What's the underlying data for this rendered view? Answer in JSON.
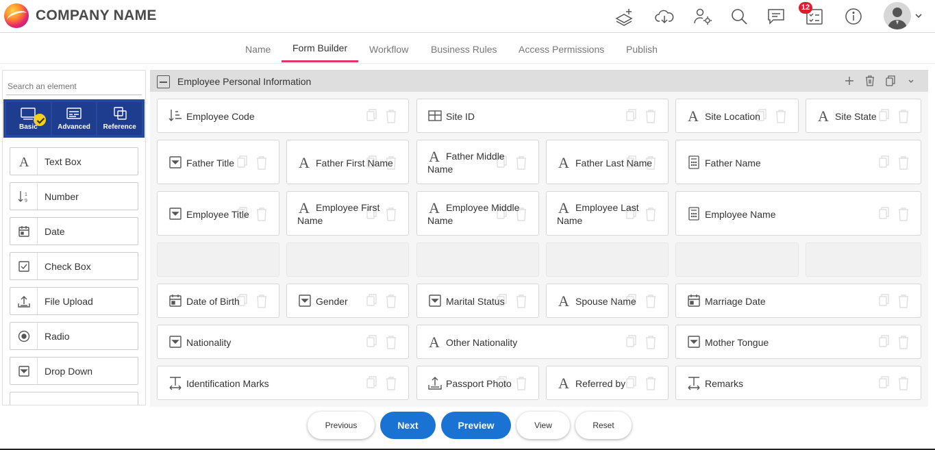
{
  "header": {
    "company_name": "COMPANY NAME",
    "notification_count": "12",
    "icons": [
      "layers-add-icon",
      "cloud-download-icon",
      "users-settings-icon",
      "search-icon",
      "chat-icon",
      "checklist-icon",
      "info-icon",
      "avatar",
      "chevron-down-icon"
    ]
  },
  "tabs": [
    {
      "label": "Name",
      "active": false
    },
    {
      "label": "Form Builder",
      "active": true
    },
    {
      "label": "Workflow",
      "active": false
    },
    {
      "label": "Business Rules",
      "active": false
    },
    {
      "label": "Access Permissions",
      "active": false
    },
    {
      "label": "Publish",
      "active": false
    }
  ],
  "palette": {
    "search_placeholder": "Search an element",
    "categories": [
      {
        "label": "Basic",
        "icon": "basic-icon",
        "selected": true
      },
      {
        "label": "Advanced",
        "icon": "advanced-icon",
        "selected": false
      },
      {
        "label": "Reference",
        "icon": "reference-icon",
        "selected": false
      }
    ],
    "elements": [
      {
        "label": "Text Box",
        "icon": "text-icon"
      },
      {
        "label": "Number",
        "icon": "number-icon"
      },
      {
        "label": "Date",
        "icon": "calendar-icon"
      },
      {
        "label": "Check Box",
        "icon": "checkbox-icon"
      },
      {
        "label": "File Upload",
        "icon": "upload-icon"
      },
      {
        "label": "Radio",
        "icon": "radio-icon"
      },
      {
        "label": "Drop Down",
        "icon": "dropdown-icon"
      }
    ]
  },
  "section": {
    "title": "Employee Personal Information",
    "fields": [
      {
        "line1": "Employee Code",
        "line2": "",
        "icon": "number-sort-icon"
      },
      {
        "line1": "Site ID",
        "line2": "",
        "icon": "table-icon"
      },
      {
        "line1": "Site Location",
        "line2": "",
        "icon": "text-icon"
      },
      {
        "line1": "Site State",
        "line2": "",
        "icon": "text-icon"
      },
      {
        "line1": "Father Title",
        "line2": "",
        "icon": "dropdown-icon"
      },
      {
        "line1": "Father First Name",
        "line2": "",
        "icon": "text-icon"
      },
      {
        "line1": "Father Middle",
        "line2": "Name",
        "icon": "text-icon"
      },
      {
        "line1": "Father Last Name",
        "line2": "",
        "icon": "text-icon"
      },
      {
        "line1": "Father Name",
        "line2": "",
        "icon": "calculator-icon"
      },
      {
        "line1": "Employee Title",
        "line2": "",
        "icon": "dropdown-icon"
      },
      {
        "line1": "Employee First",
        "line2": "Name",
        "icon": "text-icon"
      },
      {
        "line1": "Employee Middle",
        "line2": "Name",
        "icon": "text-icon"
      },
      {
        "line1": "Employee Last",
        "line2": "Name",
        "icon": "text-icon"
      },
      {
        "line1": "Employee Name",
        "line2": "",
        "icon": "calculator-icon"
      },
      {
        "line1": "Date of Birth",
        "line2": "",
        "icon": "calendar-icon"
      },
      {
        "line1": "Gender",
        "line2": "",
        "icon": "dropdown-icon"
      },
      {
        "line1": "Marital Status",
        "line2": "",
        "icon": "dropdown-icon"
      },
      {
        "line1": "Spouse Name",
        "line2": "",
        "icon": "text-icon"
      },
      {
        "line1": "Marriage Date",
        "line2": "",
        "icon": "calendar-icon"
      },
      {
        "line1": "Nationality",
        "line2": "",
        "icon": "dropdown-icon"
      },
      {
        "line1": "Other Nationality",
        "line2": "",
        "icon": "text-icon"
      },
      {
        "line1": "Mother Tongue",
        "line2": "",
        "icon": "dropdown-icon"
      },
      {
        "line1": "Identification Marks",
        "line2": "",
        "icon": "textarea-icon"
      },
      {
        "line1": "Passport Photo",
        "line2": "",
        "icon": "upload-icon"
      },
      {
        "line1": "Referred by",
        "line2": "",
        "icon": "text-icon"
      },
      {
        "line1": "Remarks",
        "line2": "",
        "icon": "textarea-icon"
      }
    ]
  },
  "buttons": {
    "previous": "Previous",
    "next": "Next",
    "preview": "Preview",
    "view": "View",
    "reset": "Reset"
  },
  "colors": {
    "accent": "#e2336b",
    "primary": "#1a73d2",
    "palette_bar": "#27489e",
    "badge": "#e21b2c"
  }
}
